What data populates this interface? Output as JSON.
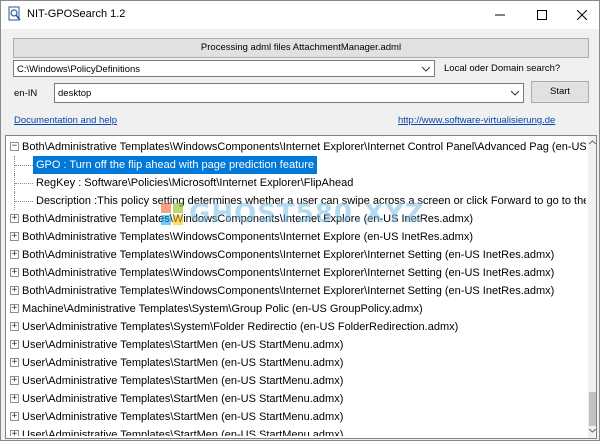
{
  "window": {
    "title": "NIT-GPOSearch 1.2"
  },
  "status": {
    "text": "Processing adml files AttachmentManager.adml"
  },
  "path_select": {
    "value": "C:\\Windows\\PolicyDefinitions"
  },
  "scope": {
    "label": "Local oder Domain search?"
  },
  "language": {
    "label": "en-IN"
  },
  "search": {
    "value": "desktop"
  },
  "start_button": {
    "label": "Start"
  },
  "links": {
    "documentation": "Documentation and help",
    "website": "http://www.software-virtualisierung.de"
  },
  "tree": {
    "rows": [
      {
        "kind": "parent",
        "expanded": true,
        "text": "Both\\Administrative Templates\\WindowsComponents\\Internet Explorer\\Internet Control Panel\\Advanced Pag   (en-US InetRes.admx)"
      },
      {
        "kind": "child",
        "selected": true,
        "text": "GPO : Turn off the flip ahead with page prediction feature"
      },
      {
        "kind": "child",
        "selected": false,
        "text": "RegKey : Software\\Policies\\Microsoft\\Internet Explorer\\FlipAhead"
      },
      {
        "kind": "child",
        "selected": false,
        "text": "Description :This policy setting determines whether a user can swipe across a screen or click Forward to go to the next"
      },
      {
        "kind": "parent",
        "expanded": false,
        "text": "Both\\Administrative Templates\\WindowsComponents\\Internet Explore   (en-US InetRes.admx)"
      },
      {
        "kind": "parent",
        "expanded": false,
        "text": "Both\\Administrative Templates\\WindowsComponents\\Internet Explore   (en-US InetRes.admx)"
      },
      {
        "kind": "parent",
        "expanded": false,
        "text": "Both\\Administrative Templates\\WindowsComponents\\Internet Explorer\\Internet Setting    (en-US InetRes.admx)"
      },
      {
        "kind": "parent",
        "expanded": false,
        "text": "Both\\Administrative Templates\\WindowsComponents\\Internet Explorer\\Internet Setting    (en-US InetRes.admx)"
      },
      {
        "kind": "parent",
        "expanded": false,
        "text": "Both\\Administrative Templates\\WindowsComponents\\Internet Explorer\\Internet Setting    (en-US InetRes.admx)"
      },
      {
        "kind": "parent",
        "expanded": false,
        "text": "Machine\\Administrative Templates\\System\\Group Polic   (en-US GroupPolicy.admx)"
      },
      {
        "kind": "parent",
        "expanded": false,
        "text": "User\\Administrative Templates\\System\\Folder Redirectio   (en-US FolderRedirection.admx)"
      },
      {
        "kind": "parent",
        "expanded": false,
        "text": "User\\Administrative Templates\\StartMen   (en-US StartMenu.admx)"
      },
      {
        "kind": "parent",
        "expanded": false,
        "text": "User\\Administrative Templates\\StartMen   (en-US StartMenu.admx)"
      },
      {
        "kind": "parent",
        "expanded": false,
        "text": "User\\Administrative Templates\\StartMen   (en-US StartMenu.admx)"
      },
      {
        "kind": "parent",
        "expanded": false,
        "text": "User\\Administrative Templates\\StartMen   (en-US StartMenu.admx)"
      },
      {
        "kind": "parent",
        "expanded": false,
        "text": "User\\Administrative Templates\\StartMen   (en-US StartMenu.admx)"
      },
      {
        "kind": "parent",
        "expanded": false,
        "text": "User\\Administrative Templates\\StartMen   (en-US StartMenu.admx)"
      }
    ]
  },
  "watermark": {
    "text": "GHOST580.XYZ"
  },
  "colors": {
    "selection": "#0078d7",
    "link": "#0645ad",
    "window_bg": "#f0f0f0"
  },
  "icons": {
    "app": "magnifier-doc-icon",
    "minimize": "minimize-icon",
    "maximize": "maximize-icon",
    "close": "close-icon"
  }
}
